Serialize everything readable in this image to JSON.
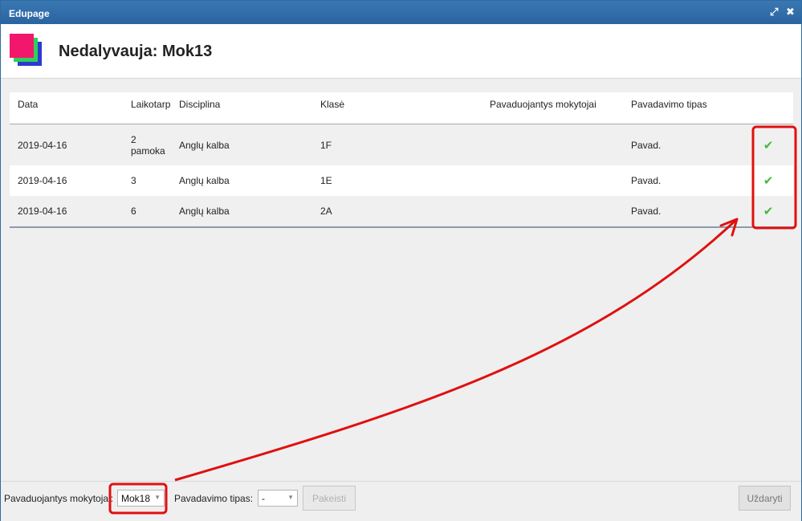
{
  "window": {
    "title": "Edupage"
  },
  "header": {
    "title": "Nedalyvauja: Mok13"
  },
  "grid": {
    "columns": [
      "Data",
      "Laikotarp",
      "Disciplina",
      "Klasė",
      "Pavaduojantys mokytojai",
      "Pavadavimo tipas"
    ],
    "rows": [
      {
        "date": "2019-04-16",
        "period": "2 pamoka",
        "subject": "Anglų kalba",
        "class": "1F",
        "teachers": "",
        "type": "Pavad."
      },
      {
        "date": "2019-04-16",
        "period": "3",
        "subject": "Anglų kalba",
        "class": "1E",
        "teachers": "",
        "type": "Pavad."
      },
      {
        "date": "2019-04-16",
        "period": "6",
        "subject": "Anglų kalba",
        "class": "2A",
        "teachers": "",
        "type": "Pavad."
      }
    ]
  },
  "footer": {
    "teacher_label": "Pavaduojantys mokytojai:",
    "teacher_value": "Mok18",
    "type_label": "Pavadavimo tipas:",
    "type_value": "-",
    "change_button": "Pakeisti",
    "close_button": "Uždaryti"
  },
  "colors": {
    "titlebar": "#2a64a0",
    "accent_red": "#e01010",
    "check_green": "#46b83c"
  },
  "icons": {
    "maximize": "maximize-icon",
    "close": "close-icon",
    "check": "check-icon",
    "dropdown": "chevron-down-icon"
  }
}
